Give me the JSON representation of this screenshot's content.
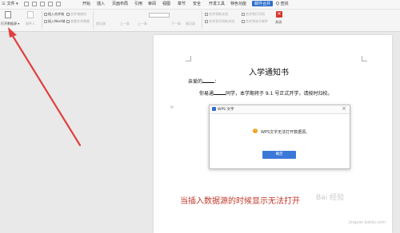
{
  "titlebar": {
    "file_menu": "三 文件 ▾",
    "menus": [
      "开始",
      "插入",
      "页面布局",
      "引用",
      "审阅",
      "视图",
      "章节",
      "安全",
      "开发工具",
      "特色功能"
    ],
    "active_menu": "邮件合并",
    "search_label": "Q 查找"
  },
  "ribbon": {
    "open_data_source": "打开数据源 ▾",
    "collect_recipients": "收件人",
    "insert_merge_field": "插入合并域",
    "insert_next_record": "插入Next域",
    "merge_field_shading": "合并域底纹",
    "query_recipients": "查看合并数据",
    "first_record": "首记录",
    "prev_record": "上一条",
    "next_record": "下一条",
    "last_record": "尾记录",
    "merge_to_new_doc": "合并到新文档",
    "merge_to_different_docs": "合并到不同新文档",
    "merge_to_printer": "合并到打印机",
    "merge_to_email": "合并到电子邮件",
    "close": "关闭",
    "close_icon_glyph": "✕"
  },
  "document": {
    "title": "入学通知书",
    "greeting": "亲爱的",
    "greeting_suffix": "：",
    "body_prefix": "你易通",
    "body_suffix": "同学，本学期将于 9.1 号正式开学，请按时归校。"
  },
  "dialog": {
    "title": "WPS 文字",
    "close_glyph": "×",
    "info_glyph": "!",
    "message": "WPS文字无法打开数据源。",
    "ok_label": "确定"
  },
  "caption": "当插入数据源的时候显示无法打开",
  "watermark": "Bai 经验",
  "watermark_sub": "jingyan.baidu.com",
  "colors": {
    "accent": "#2f6fcc",
    "close_red": "#d9342b",
    "arrow_red": "#e04040",
    "caption_red": "#c0392b"
  }
}
